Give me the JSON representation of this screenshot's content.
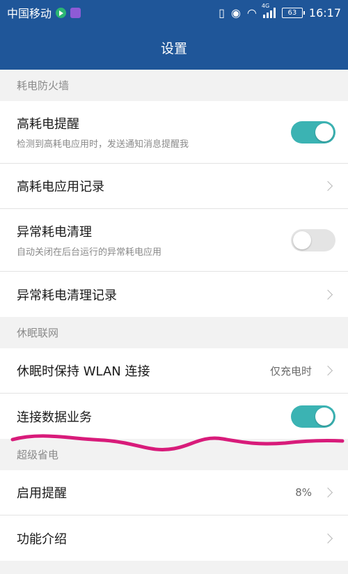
{
  "status_bar": {
    "carrier": "中国移动",
    "network_tag": "4G",
    "battery": "63",
    "time": "16:17"
  },
  "header": {
    "title": "设置"
  },
  "sections": [
    {
      "label": "耗电防火墙",
      "rows": [
        {
          "title": "高耗电提醒",
          "subtitle": "检测到高耗电应用时，发送通知消息提醒我",
          "toggle": "on"
        },
        {
          "title": "高耗电应用记录"
        },
        {
          "title": "异常耗电清理",
          "subtitle": "自动关闭在后台运行的异常耗电应用",
          "toggle": "off"
        },
        {
          "title": "异常耗电清理记录"
        }
      ]
    },
    {
      "label": "休眠联网",
      "rows": [
        {
          "title": "休眠时保持 WLAN 连接",
          "value": "仅充电时"
        },
        {
          "title": "连接数据业务",
          "toggle": "on"
        }
      ]
    },
    {
      "label": "超级省电",
      "rows": [
        {
          "title": "启用提醒",
          "value": "8%"
        },
        {
          "title": "功能介绍"
        }
      ]
    }
  ],
  "colors": {
    "header": "#1f5699",
    "toggle_on": "#3bb3b3",
    "annotation": "#d81b7a"
  }
}
